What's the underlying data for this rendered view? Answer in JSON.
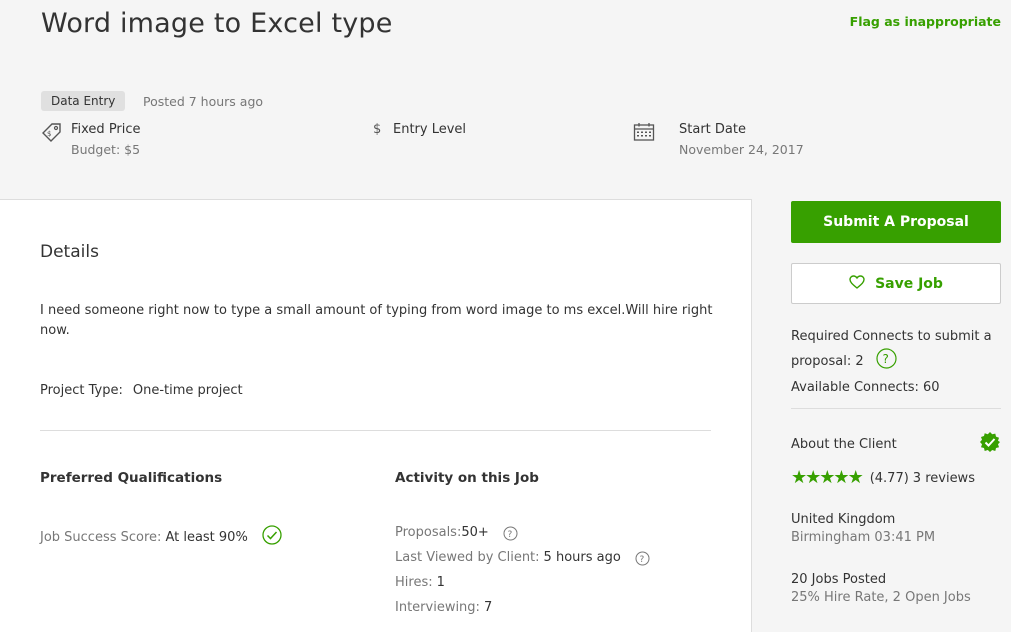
{
  "header": {
    "title": "Word image to Excel type",
    "flag_link": "Flag as inappropriate",
    "category": "Data Entry",
    "posted": "Posted 7 hours ago"
  },
  "meta": {
    "price_type": "Fixed Price",
    "budget": "Budget: $5",
    "level_symbol": "$",
    "level": "Entry Level",
    "start_label": "Start Date",
    "start_date": "November 24, 2017"
  },
  "details": {
    "heading": "Details",
    "description": "I need someone right now to type a small amount of typing from word image to ms excel.Will hire right now.",
    "project_type_label": "Project Type:",
    "project_type_value": "One-time project"
  },
  "qualifications": {
    "heading": "Preferred Qualifications",
    "jss_label": "Job Success Score:",
    "jss_value": "At least 90%"
  },
  "activity": {
    "heading": "Activity on this Job",
    "proposals_label": "Proposals:",
    "proposals_value": "50+",
    "last_viewed_label": "Last Viewed by Client:",
    "last_viewed_value": "5 hours ago",
    "hires_label": "Hires:",
    "hires_value": "1",
    "interviewing_label": "Interviewing:",
    "interviewing_value": "7"
  },
  "sidebar": {
    "submit_label": "Submit A Proposal",
    "save_label": "Save Job",
    "required_connects": "Required Connects to submit a proposal: 2",
    "available_connects": "Available Connects: 60",
    "about_client": "About the Client",
    "rating": "(4.77)",
    "reviews": "3 reviews",
    "stars": 5,
    "country": "United Kingdom",
    "city_time": "Birmingham 03:41 PM",
    "jobs_posted": "20 Jobs Posted",
    "hire_rate": "25% Hire Rate, 2 Open Jobs"
  },
  "colors": {
    "accent": "#37a000",
    "background": "#f5f5f5"
  }
}
